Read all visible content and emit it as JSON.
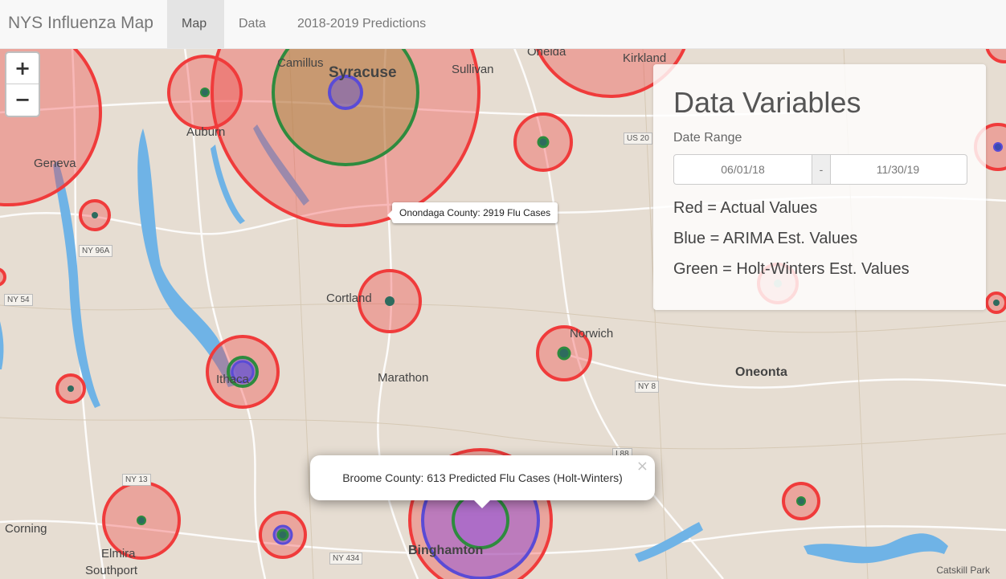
{
  "navbar": {
    "brand": "NYS Influenza Map",
    "tabs": [
      {
        "label": "Map",
        "active": true
      },
      {
        "label": "Data",
        "active": false
      },
      {
        "label": "2018-2019 Predictions",
        "active": false
      }
    ]
  },
  "zoom": {
    "in_label": "+",
    "out_label": "−"
  },
  "panel": {
    "title": "Data Variables",
    "date_range_label": "Date Range",
    "start_date": "06/01/18",
    "separator": "-",
    "end_date": "11/30/19",
    "legend": [
      "Red = Actual Values",
      "Blue = ARIMA Est. Values",
      "Green = Holt-Winters Est. Values"
    ]
  },
  "tooltip": {
    "text": "Onondaga County: 2919 Flu Cases"
  },
  "popup": {
    "text": "Broome County: 613 Predicted Flu Cases (Holt-Winters)",
    "close": "×"
  },
  "places": {
    "syracuse": "Syracuse",
    "camillus": "Camillus",
    "sullivan": "Sullivan",
    "oneida": "Oneida",
    "kirkland": "Kirkland",
    "auburn": "Auburn",
    "geneva": "Geneva",
    "cortland": "Cortland",
    "norwich": "Norwich",
    "ithaca": "Ithaca",
    "marathon": "Marathon",
    "oneonta": "Oneonta",
    "corning": "Corning",
    "elmira": "Elmira",
    "southport": "Southport",
    "binghamton": "Binghamton"
  },
  "roads": {
    "us20": "US 20",
    "ny96a": "NY 96A",
    "ny54": "NY 54",
    "ny8": "NY 8",
    "i88": "I 88",
    "ny13": "NY 13",
    "ny434": "NY 434"
  },
  "attribution": "Catskill Park",
  "colors": {
    "actual": "#f03b3b",
    "arima": "#5a4bd6",
    "holt_winters": "#2e8b3e",
    "water": "#6fb3e6",
    "land": "#e6ddd2"
  }
}
